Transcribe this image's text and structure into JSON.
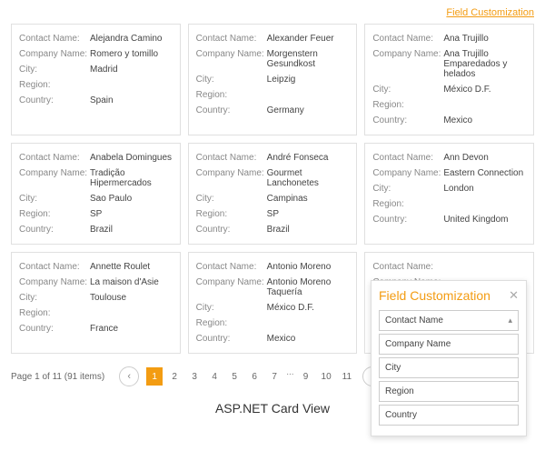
{
  "topLink": "Field Customization",
  "labels": {
    "contactName": "Contact Name:",
    "companyName": "Company Name:",
    "city": "City:",
    "region": "Region:",
    "country": "Country:"
  },
  "cards": [
    {
      "contactName": "Alejandra Camino",
      "companyName": "Romero y tomillo",
      "city": "Madrid",
      "region": "",
      "country": "Spain"
    },
    {
      "contactName": "Alexander Feuer",
      "companyName": "Morgenstern Gesundkost",
      "city": "Leipzig",
      "region": "",
      "country": "Germany"
    },
    {
      "contactName": "Ana Trujillo",
      "companyName": "Ana Trujillo Emparedados y helados",
      "city": "México D.F.",
      "region": "",
      "country": "Mexico"
    },
    {
      "contactName": "Anabela Domingues",
      "companyName": "Tradição Hipermercados",
      "city": "Sao Paulo",
      "region": "SP",
      "country": "Brazil"
    },
    {
      "contactName": "André Fonseca",
      "companyName": "Gourmet Lanchonetes",
      "city": "Campinas",
      "region": "SP",
      "country": "Brazil"
    },
    {
      "contactName": "Ann Devon",
      "companyName": "Eastern Connection",
      "city": "London",
      "region": "",
      "country": "United Kingdom"
    },
    {
      "contactName": "Annette Roulet",
      "companyName": "La maison d'Asie",
      "city": "Toulouse",
      "region": "",
      "country": "France"
    },
    {
      "contactName": "Antonio Moreno",
      "companyName": "Antonio Moreno Taquería",
      "city": "México D.F.",
      "region": "",
      "country": "Mexico"
    },
    {
      "contactName": "",
      "companyName": "",
      "city": "",
      "region": "",
      "country": ""
    }
  ],
  "pager": {
    "info": "Page 1 of 11 (91 items)",
    "prev": "‹",
    "next": "›",
    "pages": [
      "1",
      "2",
      "3",
      "4",
      "5",
      "6",
      "7",
      "...",
      "9",
      "10",
      "11"
    ],
    "activeIndex": 0
  },
  "caption": "ASP.NET Card View",
  "popup": {
    "title": "Field Customization",
    "close": "✕",
    "fields": [
      "Contact Name",
      "Company Name",
      "City",
      "Region",
      "Country"
    ]
  }
}
